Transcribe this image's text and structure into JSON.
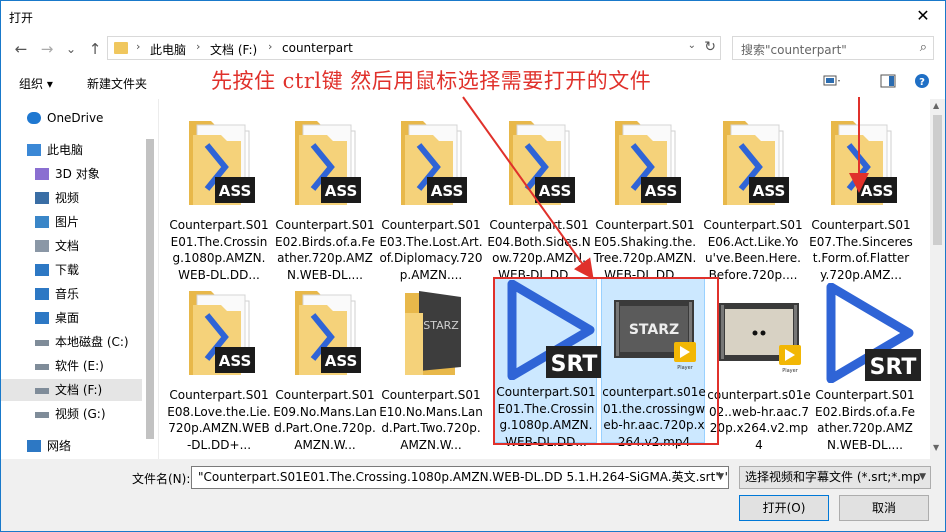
{
  "window": {
    "title": "打开",
    "close_glyph": "✕"
  },
  "nav": {
    "back": "←",
    "forward": "→",
    "up_glyph": "⌄",
    "up": "↑",
    "breadcrumb": [
      "此电脑",
      "文档 (F:)",
      "counterpart"
    ],
    "search_placeholder": "搜索\"counterpart\""
  },
  "toolbar": {
    "organize": "组织 ▾",
    "new_folder": "新建文件夹"
  },
  "instruction": "先按住 ctrl键 然后用鼠标选择需要打开的文件",
  "sidebar": [
    {
      "label": "OneDrive",
      "icon": "cloud-icon"
    },
    {
      "label": "此电脑",
      "icon": "computer-icon"
    },
    {
      "label": "3D 对象",
      "icon": "cube-icon"
    },
    {
      "label": "视频",
      "icon": "video-icon"
    },
    {
      "label": "图片",
      "icon": "picture-icon"
    },
    {
      "label": "文档",
      "icon": "document-icon"
    },
    {
      "label": "下载",
      "icon": "download-icon"
    },
    {
      "label": "音乐",
      "icon": "music-icon"
    },
    {
      "label": "桌面",
      "icon": "desktop-icon"
    },
    {
      "label": "本地磁盘 (C:)",
      "icon": "drive-icon"
    },
    {
      "label": "软件 (E:)",
      "icon": "drive-icon"
    },
    {
      "label": "文档 (F:)",
      "icon": "drive-icon"
    },
    {
      "label": "视频 (G:)",
      "icon": "drive-icon"
    },
    {
      "label": "网络",
      "icon": "network-icon"
    }
  ],
  "files": [
    {
      "name": "Counterpart.S01E01.The.Crossing.1080p.AMZN.WEB-DL.DD...",
      "type": "ass"
    },
    {
      "name": "Counterpart.S01E02.Birds.of.a.Feather.720p.AMZN.WEB-DL....",
      "type": "ass"
    },
    {
      "name": "Counterpart.S01E03.The.Lost.Art.of.Diplomacy.720p.AMZN....",
      "type": "ass"
    },
    {
      "name": "Counterpart.S01E04.Both.Sides.Now.720p.AMZN.WEB-DL.DD...",
      "type": "ass"
    },
    {
      "name": "Counterpart.S01E05.Shaking.the.Tree.720p.AMZN.WEB-DL.DD...",
      "type": "ass"
    },
    {
      "name": "Counterpart.S01E06.Act.Like.You've.Been.Here.Before.720p....",
      "type": "ass"
    },
    {
      "name": "Counterpart.S01E07.The.Sincerest.Form.of.Flattery.720p.AMZ...",
      "type": "ass"
    },
    {
      "name": "Counterpart.S01E08.Love.the.Lie.720p.AMZN.WEB-DL.DD+...",
      "type": "ass"
    },
    {
      "name": "Counterpart.S01E09.No.Mans.Land.Part.One.720p.AMZN.W...",
      "type": "ass"
    },
    {
      "name": "Counterpart.S01E10.No.Mans.Land.Part.Two.720p.AMZN.W...",
      "type": "ass"
    },
    {
      "name": "Counterpart.S01E01.The.Crossing.1080p.AMZN.WEB-DL.DD...",
      "type": "srt",
      "selected": true
    },
    {
      "name": "counterpart.s01e01.the.crossingweb-hr.aac.720p.x264.v2.mp4",
      "type": "video",
      "selected": true
    },
    {
      "name": "counterpart.s01e02..web-hr.aac.720p.x264.v2.mp4",
      "type": "video2"
    },
    {
      "name": "Counterpart.S01E02.Birds.of.a.Feather.720p.AMZN.WEB-DL....",
      "type": "srt"
    }
  ],
  "icon_badges": {
    "ass": "ASS",
    "srt": "SRT",
    "starz": "STARZ",
    "player": "Player"
  },
  "bottom": {
    "filename_label": "文件名(N):",
    "filename_value": "\"Counterpart.S01E01.The.Crossing.1080p.AMZN.WEB-DL.DD 5.1.H.264-SiGMA.英文.srt\" \"c",
    "filetype_value": "选择视频和字幕文件 (*.srt;*.mp",
    "open_button": "打开(O)",
    "cancel_button": "取消"
  },
  "colors": {
    "annotation": "#e0312b",
    "selection": "#cce8ff",
    "accent": "#0078d7"
  }
}
